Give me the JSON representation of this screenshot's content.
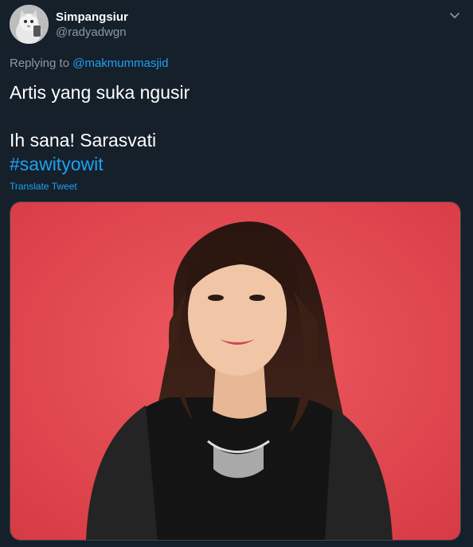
{
  "tweet": {
    "display_name": "Simpangsiur",
    "handle": "@radyadwgn",
    "replying_prefix": "Replying to",
    "replying_to": "@makmummasjid",
    "text_line1": "Artis yang suka ngusir",
    "text_line2": "Ih sana! Sarasvati",
    "hashtag": "#sawityowit",
    "translate_label": "Translate Tweet"
  },
  "icons": {
    "menu": "chevron-down-icon",
    "avatar": "avatar"
  },
  "colors": {
    "background": "#15202b",
    "link": "#1da1f2",
    "secondary": "#8899a6",
    "photo_background": "#e0464e"
  }
}
